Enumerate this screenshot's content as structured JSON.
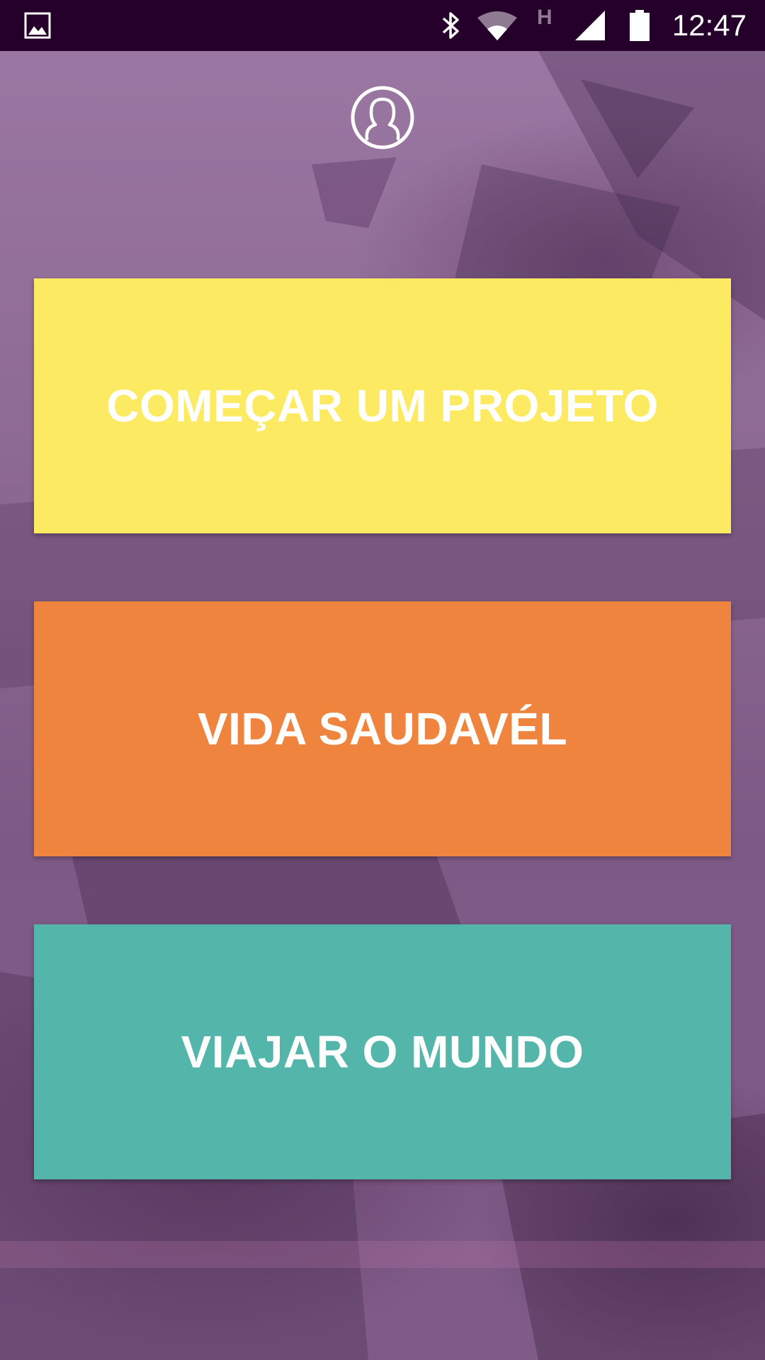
{
  "status_bar": {
    "time": "12:47",
    "network_letter": "H",
    "icons": [
      "gallery-notification-icon",
      "bluetooth-icon",
      "wifi-icon",
      "cell-signal-icon",
      "battery-icon"
    ]
  },
  "profile": {
    "icon": "user-profile-icon"
  },
  "tiles": [
    {
      "label": "COMEÇAR UM PROJETO",
      "color": "#fceb62"
    },
    {
      "label": "VIDA SAUDAVÉL",
      "color": "#ef843e"
    },
    {
      "label": "VIAJAR O MUNDO",
      "color": "#54b5aa"
    }
  ],
  "colors": {
    "status_bar": "#24002a",
    "background_tint": "#8a5f8c"
  }
}
